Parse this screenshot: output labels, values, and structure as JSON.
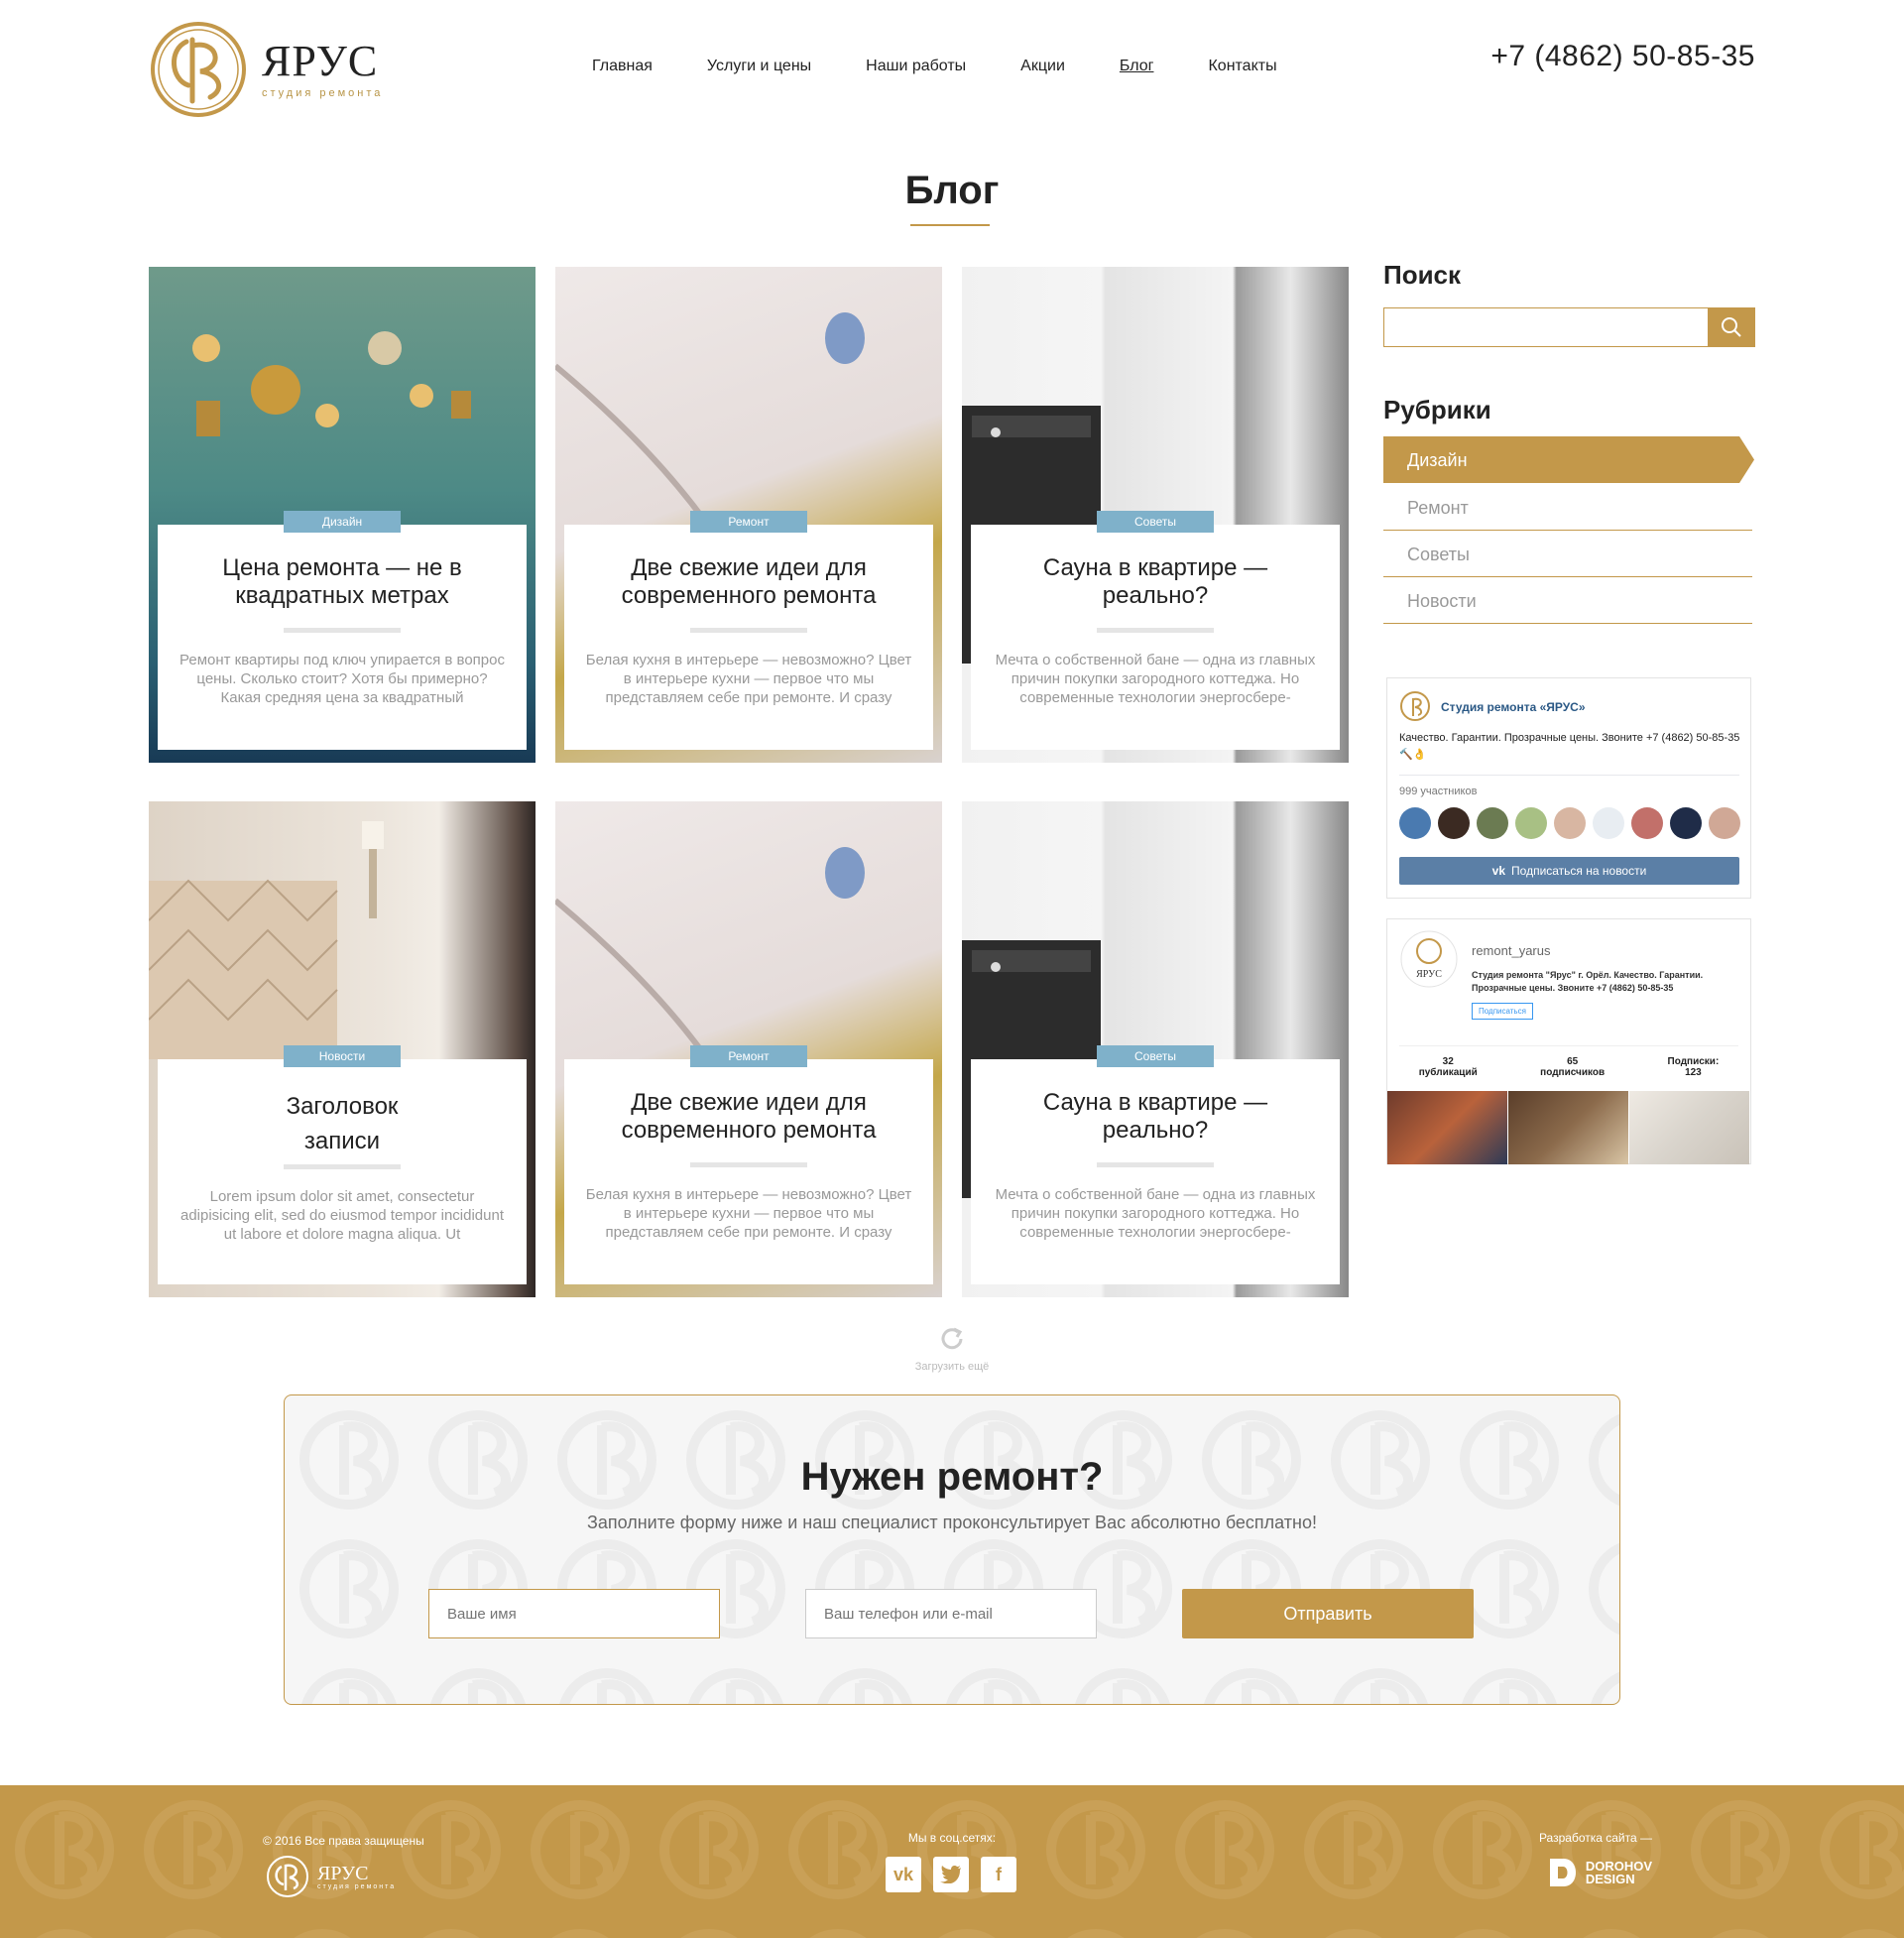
{
  "header": {
    "logo_name": "ЯРУС",
    "logo_sub": "студия ремонта",
    "nav": [
      "Главная",
      "Услуги и цены",
      "Наши работы",
      "Акции",
      "Блог",
      "Контакты"
    ],
    "phone": "+7 (4862) 50-85-35"
  },
  "page_title": "Блог",
  "posts": [
    {
      "tag": "Дизайн",
      "title": "Цена ремонта — не в квадратных метрах",
      "text": "Ремонт квартиры под ключ упирается в вопрос цены. Сколько стоит? Хотя бы примерно? Какая средняя цена за квадратный"
    },
    {
      "tag": "Ремонт",
      "title": "Две свежие идеи для современного ремонта",
      "text": "Белая кухня в интерьере — невозможно? Цвет в интерьере кухни — первое что мы представляем себе при ремонте. И сразу"
    },
    {
      "tag": "Советы",
      "title": "Сауна в квартире — реально?",
      "text": "Мечта о собственной бане — одна из главных причин покупки загородного коттеджа. Но современные технологии энергосбере-"
    },
    {
      "tag": "Новости",
      "title": "Заголовок записи",
      "text": "Lorem ipsum dolor sit amet, consectetur adipisicing elit, sed do eiusmod tempor incididunt ut labore et dolore magna aliqua. Ut"
    },
    {
      "tag": "Ремонт",
      "title": "Две свежие идеи для современного ремонта",
      "text": "Белая кухня в интерьере — невозможно? Цвет в интерьере кухни — первое что мы представляем себе при ремонте. И сразу"
    },
    {
      "tag": "Советы",
      "title": "Сауна в квартире — реально?",
      "text": "Мечта о собственной бане — одна из главных причин покупки загородного коттеджа. Но современные технологии энергосбере-"
    }
  ],
  "sidebar": {
    "search_heading": "Поиск",
    "rubrics_heading": "Рубрики",
    "rubrics": [
      "Дизайн",
      "Ремонт",
      "Советы",
      "Новости"
    ]
  },
  "vk_widget": {
    "title": "Студия ремонта «ЯРУС»",
    "description": "Качество. Гарантии. Прозрачные цены. Звоните +7 (4862) 50-85-35 🔨👌",
    "members": "999 участников",
    "subscribe": "Подписаться на новости"
  },
  "ig_widget": {
    "username": "remont_yarus",
    "description": "Студия ремонта \"Ярус\" г. Орёл. Качество. Гарантии. Прозрачные цены. Звоните +7 (4862) 50-85-35",
    "follow": "Подписаться",
    "stats": [
      {
        "value": "32",
        "label": "публикаций"
      },
      {
        "value": "65",
        "label": "подписчиков"
      },
      {
        "value": "123",
        "label": "Подписки:"
      }
    ]
  },
  "load_more": "Загрузить ещё",
  "form": {
    "title": "Нужен ремонт?",
    "subtitle": "Заполните форму ниже и наш специалист проконсультирует Вас абсолютно бесплатно!",
    "name_placeholder": "Ваше имя",
    "contact_placeholder": "Ваш телефон или e-mail",
    "submit": "Отправить"
  },
  "footer": {
    "copyright": "© 2016 Все права защищены",
    "logo_name": "ЯРУС",
    "logo_sub": "студия ремонта",
    "social_title": "Мы в соц.сетях:",
    "social": [
      "vk-icon",
      "twitter-icon",
      "facebook-icon"
    ],
    "dev_title": "Разработка сайта —",
    "dev_name": [
      "DOROHOV",
      "DESIGN"
    ]
  },
  "colors": {
    "accent": "#c3984a",
    "tag": "#7fb1ca",
    "vk": "#5b7fa6"
  }
}
